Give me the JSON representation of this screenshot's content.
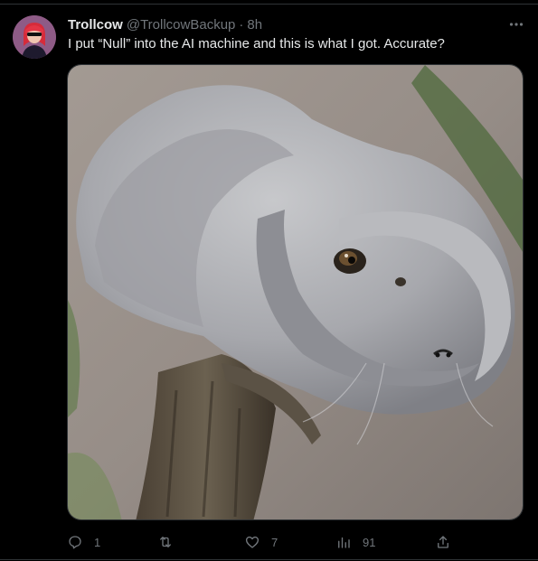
{
  "tweet": {
    "display_name": "Trollcow",
    "handle": "@TrollcowBackup",
    "separator": "·",
    "time": "8h",
    "text": "I put “Null” into the AI machine and this is what I got. Accurate?",
    "media_alt": "AI-generated image of a grey furry creature coiled on a branch"
  },
  "actions": {
    "reply_count": "1",
    "retweet_count": "",
    "like_count": "7",
    "views_count": "91"
  },
  "colors": {
    "background": "#000000",
    "primary_text": "#e7e9ea",
    "secondary_text": "#71767b",
    "divider": "#2f3336"
  },
  "icons": [
    "more-icon",
    "reply-icon",
    "retweet-icon",
    "like-icon",
    "views-icon",
    "share-icon"
  ]
}
